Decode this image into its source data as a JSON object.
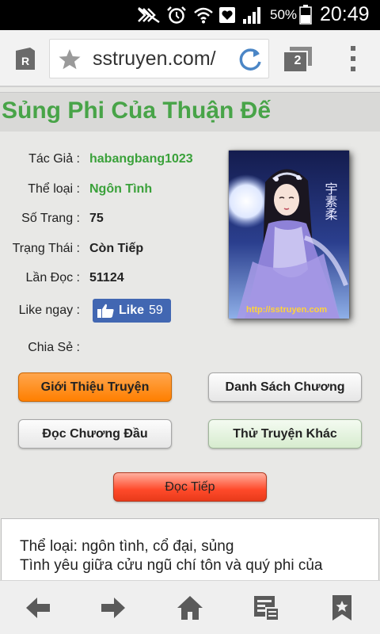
{
  "status_bar": {
    "battery_percent": "50%",
    "time": "20:49"
  },
  "browser": {
    "url": "sstruyen.com/",
    "tab_count": "2",
    "icons": [
      "r-reader-icon",
      "star-icon",
      "reload-icon",
      "tabs-icon",
      "menu-icon"
    ]
  },
  "page": {
    "title": "Sủng Phi Của Thuận Đế",
    "title_color": "#48a448",
    "info": {
      "author_label": "Tác Giả :",
      "author_value": "habangbang1023",
      "genre_label": "Thể loại :",
      "genre_value": "Ngôn Tình",
      "pages_label": "Số Trang :",
      "pages_value": "75",
      "status_label": "Trạng Thái :",
      "status_value": "Còn Tiếp",
      "reads_label": "Lần Đọc :",
      "reads_value": "51124",
      "like_label": "Like ngay :",
      "share_label": "Chia Sẻ :"
    },
    "like_button": {
      "label": "Like",
      "count": "59"
    },
    "cover": {
      "calligraphy": "宇素柔",
      "watermark": "http://sstruyen.com"
    },
    "buttons": {
      "intro": "Giới Thiệu Truyện",
      "chapter_list": "Danh Sách Chương",
      "read_first": "Đọc Chương Đầu",
      "try_other": "Thử Truyện Khác",
      "continue": "Đọc Tiếp"
    },
    "description": {
      "line1": "Thể loại: ngôn tình, cổ đại, sủng",
      "line2": "Tình yêu giữa cửu ngũ chí tôn và quý phi của"
    }
  },
  "bottom_nav": {
    "icons": [
      "back-arrow-icon",
      "forward-arrow-icon",
      "home-icon",
      "reader-mode-icon",
      "bookmark-icon"
    ]
  }
}
